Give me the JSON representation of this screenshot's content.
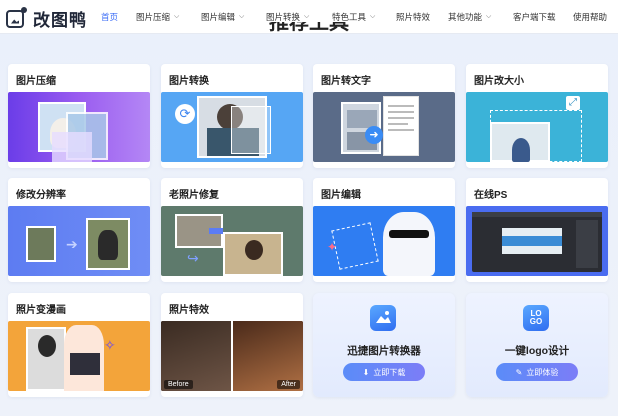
{
  "header": {
    "logo_text": "改图鸭",
    "nav": [
      {
        "label": "首页",
        "active": true,
        "dropdown": false
      },
      {
        "label": "图片压缩",
        "dropdown": true
      },
      {
        "label": "图片编辑",
        "dropdown": true
      },
      {
        "label": "图片转换",
        "dropdown": true
      },
      {
        "label": "特色工具",
        "dropdown": true
      },
      {
        "label": "照片特效",
        "dropdown": false
      },
      {
        "label": "其他功能",
        "dropdown": true
      },
      {
        "label": "客户端下载",
        "dropdown": false
      },
      {
        "label": "使用帮助",
        "dropdown": false
      }
    ]
  },
  "section_title": "推荐工具",
  "cards": [
    {
      "title": "图片压缩"
    },
    {
      "title": "图片转换"
    },
    {
      "title": "图片转文字"
    },
    {
      "title": "图片改大小"
    },
    {
      "title": "修改分辨率"
    },
    {
      "title": "老照片修复"
    },
    {
      "title": "图片编辑"
    },
    {
      "title": "在线PS"
    },
    {
      "title": "照片变漫画"
    },
    {
      "title": "照片特效",
      "before": "Before",
      "after": "After"
    }
  ],
  "promos": [
    {
      "title": "迅捷图片转换器",
      "button": "立即下载",
      "icon": "image-converter-app-icon"
    },
    {
      "title": "一键logo设计",
      "button": "立即体验",
      "icon": "logo-design-app-icon",
      "icon_text": "LO GO"
    }
  ],
  "colors": {
    "accent": "#3b6cf6",
    "active_nav": "#3b6cf6"
  }
}
